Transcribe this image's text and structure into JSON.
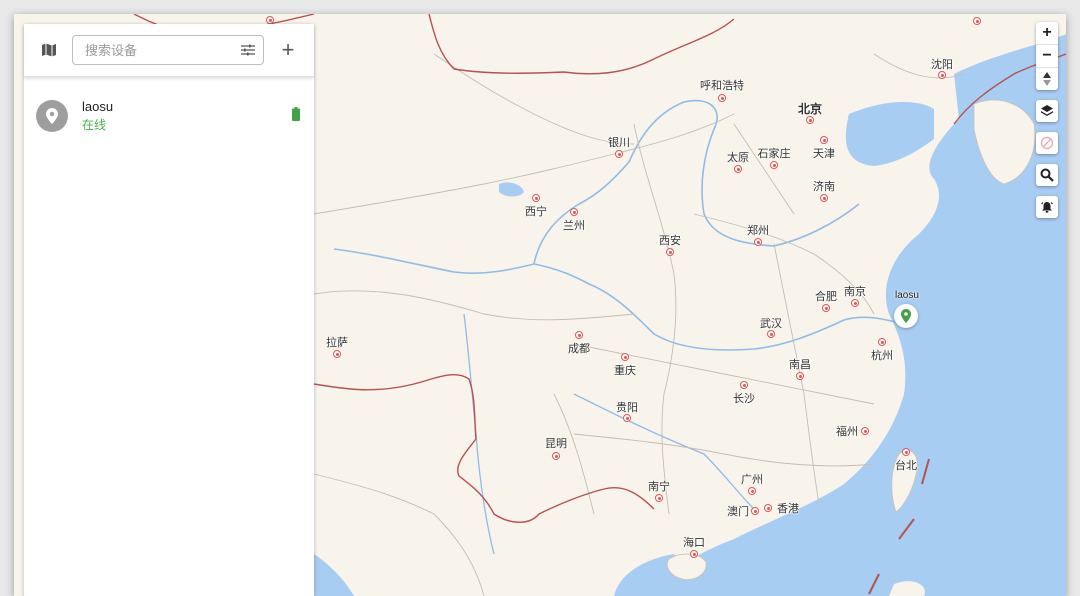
{
  "toolbar": {
    "map_icon": "map-icon",
    "search_placeholder": "搜索设备",
    "filter_icon": "filter-sliders-icon",
    "add_label": "+"
  },
  "devices": [
    {
      "name": "laosu",
      "status": "在线",
      "icon": "location-pin-icon",
      "battery_icon": "battery-full-icon"
    }
  ],
  "map_controls": {
    "zoom_in": "+",
    "zoom_out": "−",
    "compass_icon": "compass-icon",
    "layers_icon": "layers-icon",
    "disabled_icon": "block-icon",
    "search_icon": "search-icon",
    "alarm_icon": "alarm-icon"
  },
  "marker": {
    "label": "laosu"
  },
  "cities": {
    "c1": "沈阳",
    "c2": "呼和浩特",
    "c3": "北京",
    "c4": "银川",
    "c5": "太原",
    "c6": "石家庄",
    "c7": "天津",
    "c8": "济南",
    "c9": "西宁",
    "c10": "兰州",
    "c11": "西安",
    "c12": "郑州",
    "c13": "合肥",
    "c14": "南京",
    "c15": "拉萨",
    "c16": "成都",
    "c17": "武汉",
    "c18": "重庆",
    "c19": "南昌",
    "c20": "杭州",
    "c21": "长沙",
    "c22": "贵阳",
    "c23": "福州",
    "c24": "台北",
    "c25": "昆明",
    "c26": "广州",
    "c27": "南宁",
    "c28": "澳门",
    "c29": "香港",
    "c30": "海口"
  },
  "colors": {
    "accent_green": "#4caf50",
    "sea": "#a8cdf2",
    "land": "#f8f4ec",
    "border": "#b5524e"
  }
}
